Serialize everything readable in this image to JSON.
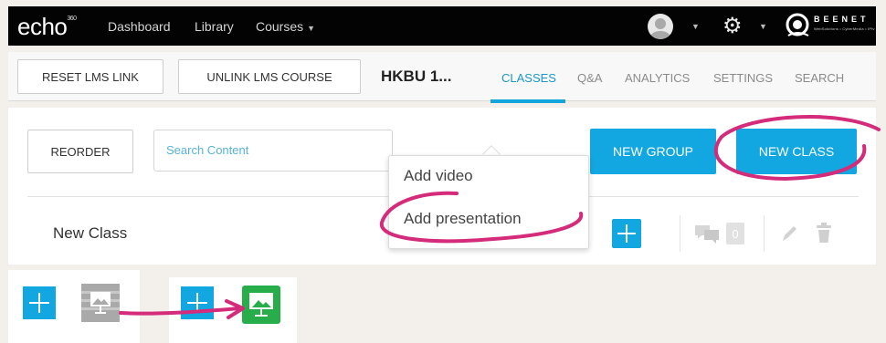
{
  "nav": {
    "logo": "echo",
    "logo_sup": "360",
    "links": [
      "Dashboard",
      "Library",
      "Courses"
    ],
    "brand_word": "BEENET",
    "brand_sub": "WebSolutions • CyberMedia • IPtv",
    "icons": {
      "user": "avatar-icon",
      "settings": "gear-icon"
    }
  },
  "header": {
    "reset_label": "RESET LMS LINK",
    "unlink_label": "UNLINK LMS COURSE",
    "course_title": "HKBU 1...",
    "tabs": [
      "CLASSES",
      "Q&A",
      "ANALYTICS",
      "SETTINGS",
      "SEARCH"
    ],
    "active_tab": "CLASSES"
  },
  "toolbar": {
    "reorder_label": "REORDER",
    "search_placeholder": "Search Content",
    "new_group_label": "NEW GROUP",
    "new_class_label": "NEW CLASS"
  },
  "dropdown": {
    "items": [
      "Add video",
      "Add presentation"
    ]
  },
  "class_row": {
    "name": "New Class",
    "comment_count": "0"
  },
  "colors": {
    "accent_blue": "#12a7e0",
    "present_green": "#27ad4a",
    "annotation_pink": "#d42b7a"
  }
}
